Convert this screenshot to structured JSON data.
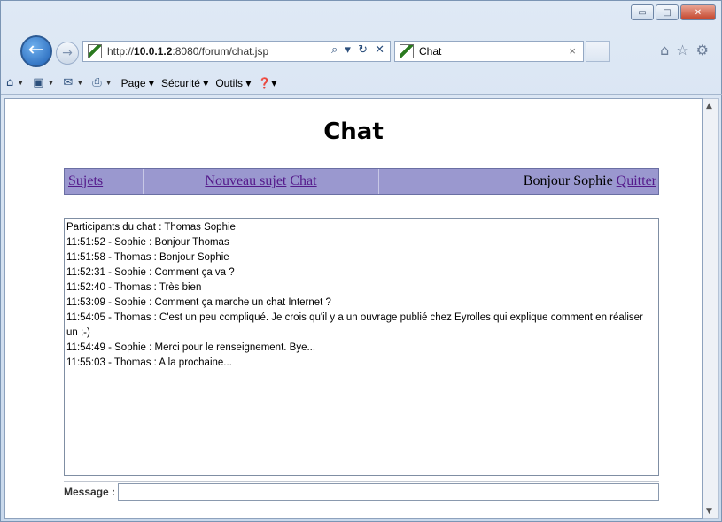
{
  "browser": {
    "url_prefix": "http://",
    "url_host": "10.0.1.2",
    "url_rest": ":8080/forum/chat.jsp",
    "address_tools": "⌕ ▾ ↻ ✕",
    "tab_title": "Chat",
    "tab_close": "×",
    "window_buttons": {
      "minimize": "▭",
      "maximize": "□",
      "close": "✕"
    },
    "right_icons": "⌂☆⚙",
    "command_bar": {
      "page": "Page ▾",
      "security": "Sécurité ▾",
      "tools": "Outils ▾",
      "help": "❓▾"
    }
  },
  "page": {
    "title": "Chat",
    "menu": {
      "topics": "Sujets",
      "new_topic": "Nouveau sujet",
      "chat": "Chat",
      "greeting": "Bonjour Sophie",
      "quit": "Quitter"
    },
    "chat_lines": [
      "Participants du chat : Thomas Sophie",
      "11:51:52 - Sophie : Bonjour Thomas",
      "11:51:58 - Thomas : Bonjour Sophie",
      "11:52:31 - Sophie : Comment ça va ?",
      "11:52:40 - Thomas : Très bien",
      "11:53:09 - Sophie : Comment ça marche un chat Internet ?",
      "11:54:05 - Thomas : C'est un peu compliqué. Je crois qu'il y a un ouvrage publié chez Eyrolles qui explique comment en réaliser un ;-)",
      "11:54:49 - Sophie : Merci pour le renseignement. Bye...",
      "11:55:03 - Thomas : A la prochaine..."
    ],
    "message_label": "Message :",
    "message_value": ""
  }
}
